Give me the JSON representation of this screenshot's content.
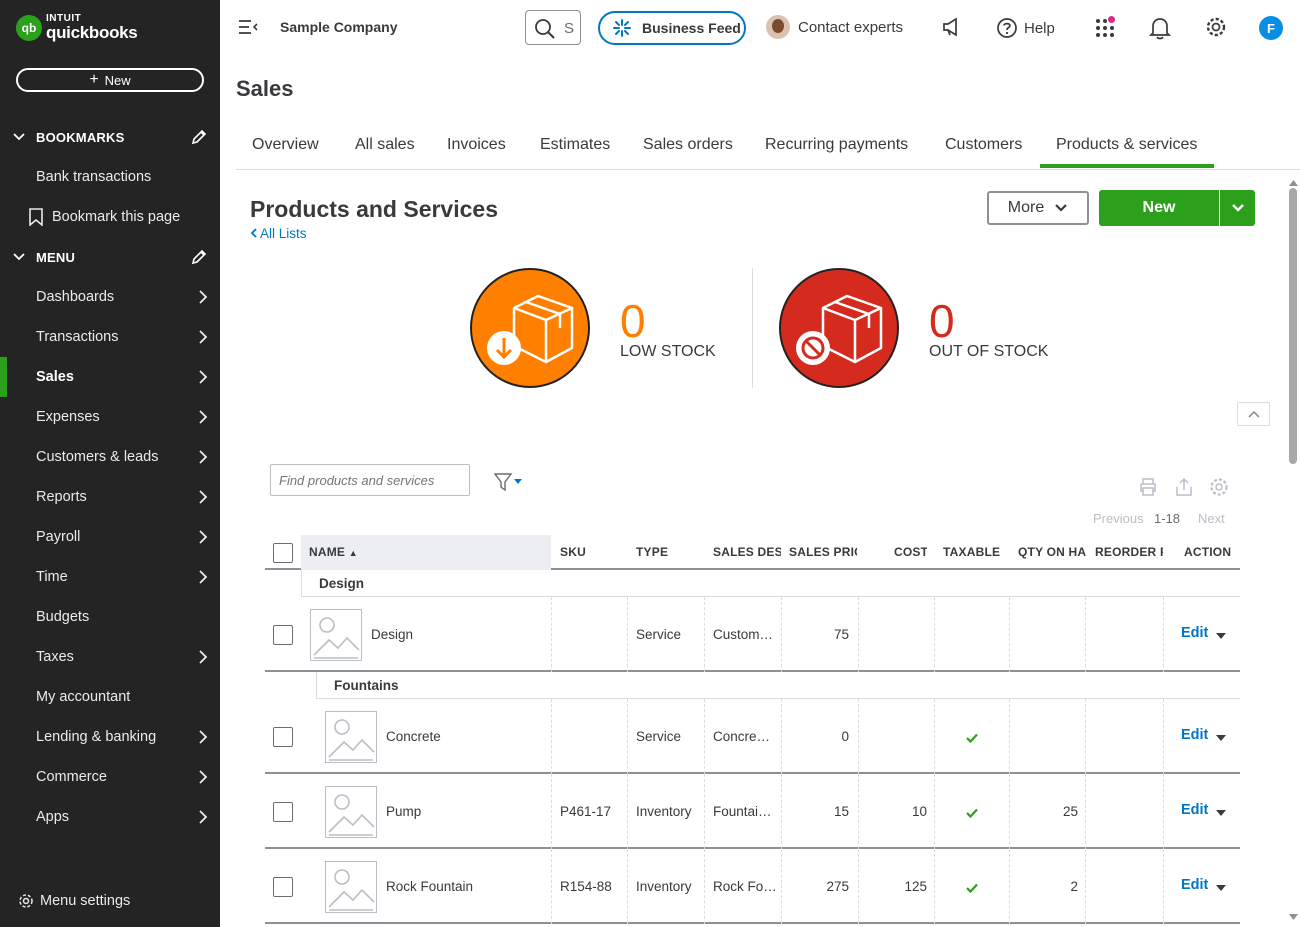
{
  "brand": {
    "top": "INTUIT",
    "name": "quickbooks",
    "mark": "qb"
  },
  "sidebar": {
    "new_label": "New",
    "bookmarks_label": "BOOKMARKS",
    "bookmark_items": [
      "Bank transactions",
      "Bookmark this page"
    ],
    "menu_label": "MENU",
    "items": [
      {
        "label": "Dashboards",
        "arrow": true
      },
      {
        "label": "Transactions",
        "arrow": true
      },
      {
        "label": "Sales",
        "arrow": true,
        "active": true
      },
      {
        "label": "Expenses",
        "arrow": true
      },
      {
        "label": "Customers & leads",
        "arrow": true
      },
      {
        "label": "Reports",
        "arrow": true
      },
      {
        "label": "Payroll",
        "arrow": true
      },
      {
        "label": "Time",
        "arrow": true
      },
      {
        "label": "Budgets",
        "arrow": false
      },
      {
        "label": "Taxes",
        "arrow": true
      },
      {
        "label": "My accountant",
        "arrow": false
      },
      {
        "label": "Lending & banking",
        "arrow": true
      },
      {
        "label": "Commerce",
        "arrow": true
      },
      {
        "label": "Apps",
        "arrow": true
      }
    ],
    "menu_settings": "Menu settings"
  },
  "topbar": {
    "company": "Sample Company",
    "search_text": "S",
    "business_feed": "Business Feed",
    "contact": "Contact experts",
    "help": "Help",
    "user_initial": "F"
  },
  "page": {
    "title": "Sales",
    "tabs": [
      "Overview",
      "All sales",
      "Invoices",
      "Estimates",
      "Sales orders",
      "Recurring payments",
      "Customers",
      "Products & services"
    ],
    "active_tab": "Products & services"
  },
  "content": {
    "title": "Products and Services",
    "all_lists": "All Lists",
    "more": "More",
    "new": "New",
    "low_stock": {
      "count": "0",
      "label": "LOW STOCK"
    },
    "out_of_stock": {
      "count": "0",
      "label": "OUT OF STOCK"
    },
    "search_placeholder": "Find products and services",
    "pager": {
      "previous": "Previous",
      "range": "1-18",
      "next": "Next"
    }
  },
  "table": {
    "headers": [
      "NAME",
      "SKU",
      "TYPE",
      "SALES DESC",
      "SALES PRICE",
      "COST",
      "TAXABLE",
      "QTY ON HAND",
      "REORDER POINT",
      "ACTION"
    ],
    "groups": [
      {
        "name": "Design",
        "rows": [
          {
            "name": "Design",
            "sku": "",
            "type": "Service",
            "desc": "Custom…",
            "price": "75",
            "cost": "",
            "taxable": false,
            "qty": "",
            "reorder": "",
            "action": "Edit"
          }
        ]
      },
      {
        "name": "Fountains",
        "rows": [
          {
            "name": "Concrete",
            "sku": "",
            "type": "Service",
            "desc": "Concre…",
            "price": "0",
            "cost": "",
            "taxable": true,
            "qty": "",
            "reorder": "",
            "action": "Edit"
          },
          {
            "name": "Pump",
            "sku": "P461-17",
            "type": "Inventory",
            "desc": "Fountai…",
            "price": "15",
            "cost": "10",
            "taxable": true,
            "qty": "25",
            "reorder": "",
            "action": "Edit"
          },
          {
            "name": "Rock Fountain",
            "sku": "R154-88",
            "type": "Inventory",
            "desc": "Rock Fo…",
            "price": "275",
            "cost": "125",
            "taxable": true,
            "qty": "2",
            "reorder": "",
            "action": "Edit"
          }
        ]
      }
    ]
  },
  "colors": {
    "brand_green": "#2ca01c",
    "link_blue": "#0077c5",
    "low_stock": "#ff8000",
    "out_of_stock": "#d52b1e",
    "sidebar_bg": "#242424"
  },
  "icons": [
    "search-icon",
    "sparkle-icon",
    "megaphone-icon",
    "help-icon",
    "apps-grid-icon",
    "bell-icon",
    "gear-icon",
    "pencil-icon",
    "bookmark-icon",
    "chevron-right-icon",
    "chevron-down-icon",
    "box-icon",
    "download-icon",
    "ban-icon",
    "filter-icon",
    "print-icon",
    "export-icon",
    "checkmark-icon",
    "image-placeholder-icon"
  ]
}
